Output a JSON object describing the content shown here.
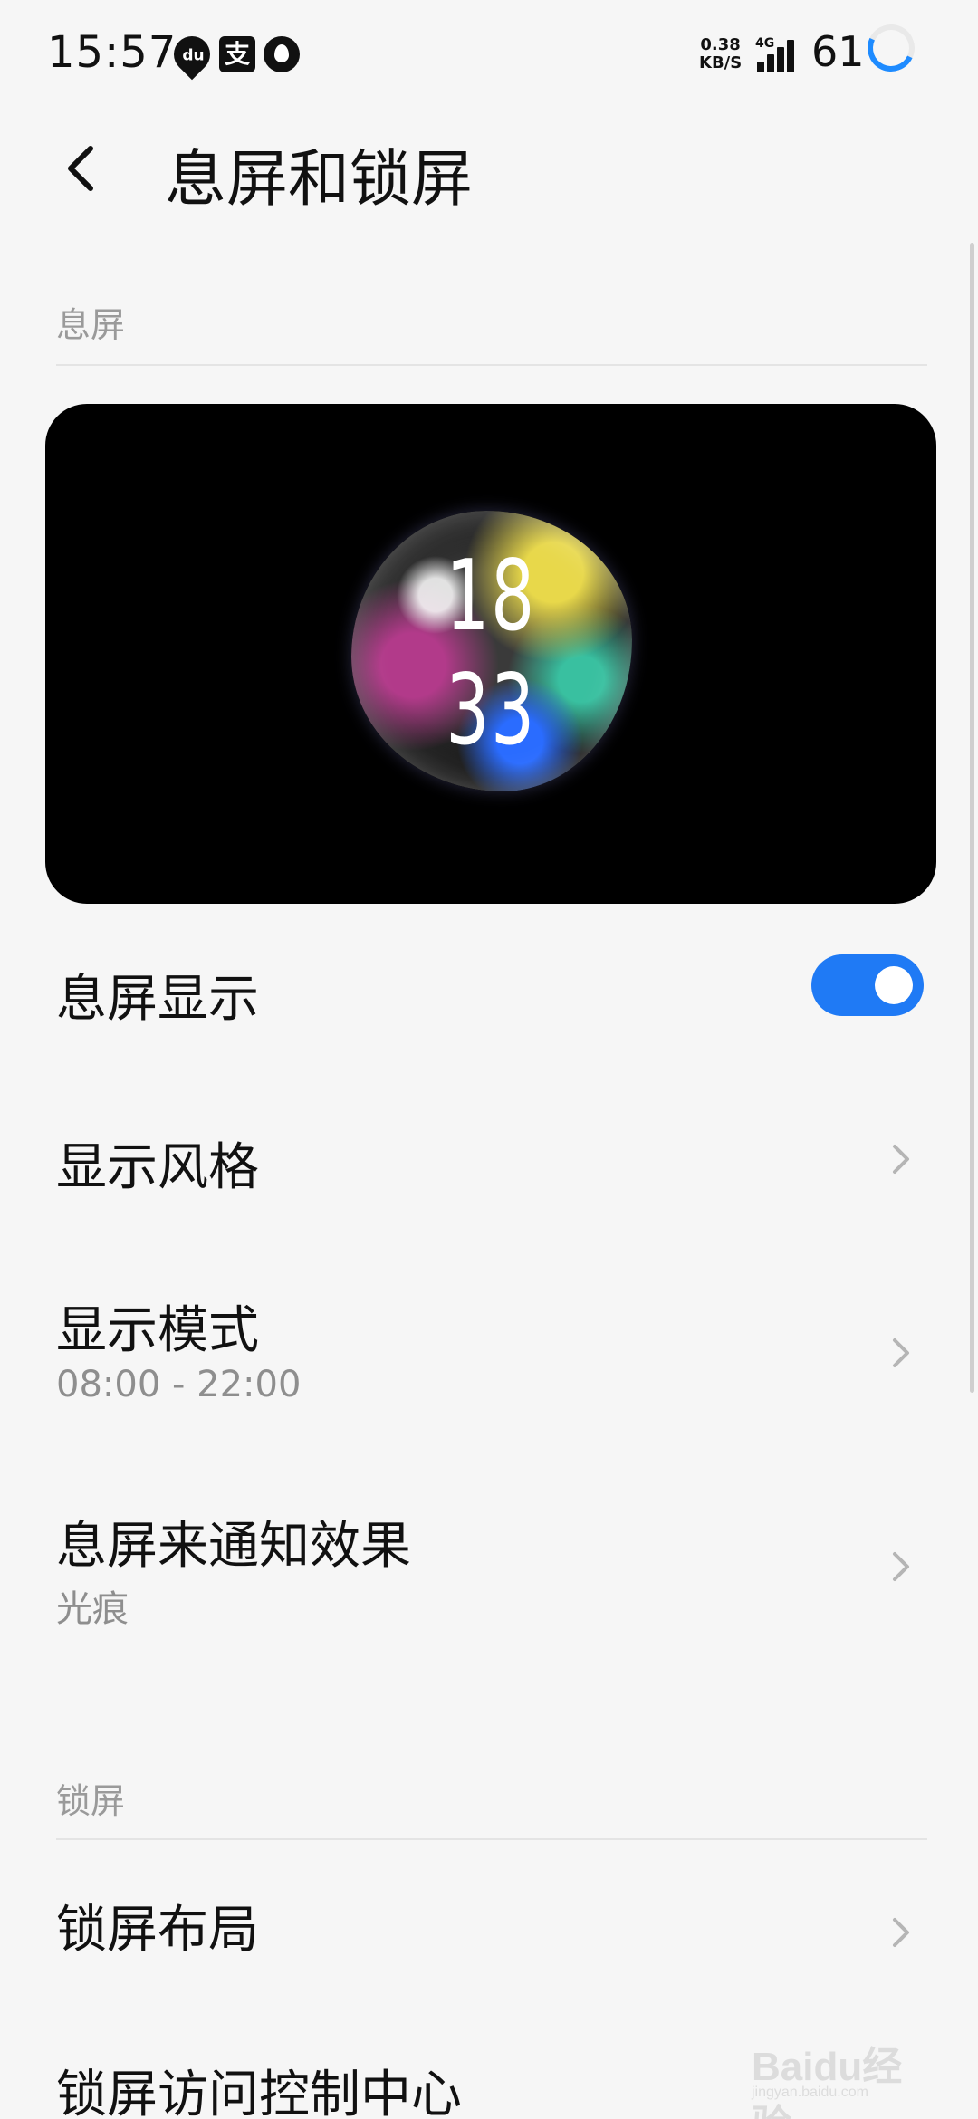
{
  "status_bar": {
    "time": "15:57",
    "net_speed_value": "0.38",
    "net_speed_unit": "KB/S",
    "network_type": "4G",
    "battery": "61",
    "icons": [
      "location-du-icon",
      "alipay-icon",
      "droplet-app-icon",
      "signal-icon",
      "battery-ring-icon"
    ]
  },
  "header": {
    "title": "息屏和锁屏",
    "back_icon": "chevron-left-icon"
  },
  "aod_section": {
    "header": "息屏",
    "preview": {
      "hour": "18",
      "minute": "33"
    }
  },
  "rows": {
    "aod_display": {
      "title": "息屏显示",
      "toggle_on": true
    },
    "display_style": {
      "title": "显示风格"
    },
    "display_mode": {
      "title": "显示模式",
      "subtitle": "08:00 - 22:00"
    },
    "notification_effect": {
      "title": "息屏来通知效果",
      "subtitle": "光痕"
    }
  },
  "lock_section": {
    "header": "锁屏",
    "rows": {
      "layout": {
        "title": "锁屏布局"
      },
      "control_center": {
        "title": "锁屏访问控制中心"
      }
    }
  },
  "watermark": {
    "logo": "Baidu经验",
    "url": "jingyan.baidu.com"
  },
  "colors": {
    "accent": "#1f7af5",
    "background": "#f6f6f6",
    "secondary_text": "#8e8e8e"
  }
}
